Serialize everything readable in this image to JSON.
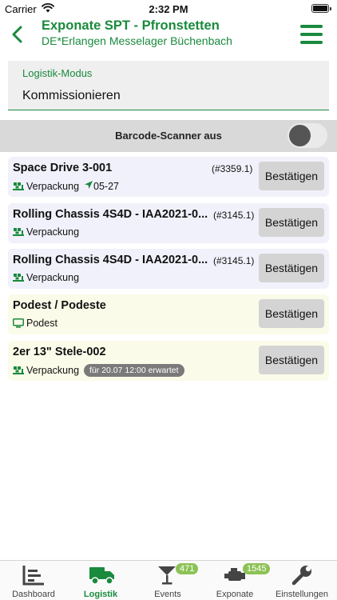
{
  "status": {
    "carrier": "Carrier",
    "time": "2:32 PM"
  },
  "header": {
    "title": "Exponate SPT - Pfronstetten",
    "subtitle": "DE*Erlangen Messelager Büchenbach"
  },
  "mode": {
    "label": "Logistik-Modus",
    "value": "Kommissionieren"
  },
  "scanner": {
    "label": "Barcode-Scanner aus",
    "enabled": false
  },
  "items": [
    {
      "title": "Space Drive 3-001",
      "number": "(#3359.1)",
      "icon": "pallet-icon",
      "type": "Verpackung",
      "location": "05-27",
      "badge": "",
      "button": "Bestätigen",
      "color": "#f1f1fb"
    },
    {
      "title": "Rolling Chassis 4S4D - IAA2021-0...",
      "number": "(#3145.1)",
      "icon": "pallet-icon",
      "type": "Verpackung",
      "location": "",
      "badge": "",
      "button": "Bestätigen",
      "color": "#f1f1fb"
    },
    {
      "title": "Rolling Chassis 4S4D - IAA2021-0...",
      "number": "(#3145.1)",
      "icon": "pallet-icon",
      "type": "Verpackung",
      "location": "",
      "badge": "",
      "button": "Bestätigen",
      "color": "#f1f1fb"
    },
    {
      "title": "Podest / Podeste",
      "number": "",
      "icon": "monitor-icon",
      "type": "Podest",
      "location": "",
      "badge": "",
      "button": "Bestätigen",
      "color": "#fbfbe9"
    },
    {
      "title": "2er 13\" Stele-002",
      "number": "",
      "icon": "pallet-icon",
      "type": "Verpackung",
      "location": "",
      "badge": "für 20.07 12:00 erwartet",
      "button": "Bestätigen",
      "color": "#fbfbe9"
    }
  ],
  "tabs": [
    {
      "label": "Dashboard",
      "icon": "dashboard-chart-icon",
      "badge": "",
      "active": false
    },
    {
      "label": "Logistik",
      "icon": "truck-icon",
      "badge": "",
      "active": true
    },
    {
      "label": "Events",
      "icon": "cocktail-glass-icon",
      "badge": "471",
      "active": false
    },
    {
      "label": "Exponate",
      "icon": "engine-icon",
      "badge": "1545",
      "active": false
    },
    {
      "label": "Einstellungen",
      "icon": "wrench-icon",
      "badge": "",
      "active": false
    }
  ],
  "colors": {
    "accent": "#1a8a3c",
    "badge": "#8cc255",
    "item_blue": "#f1f1fb",
    "item_yellow": "#fbfbe9"
  }
}
